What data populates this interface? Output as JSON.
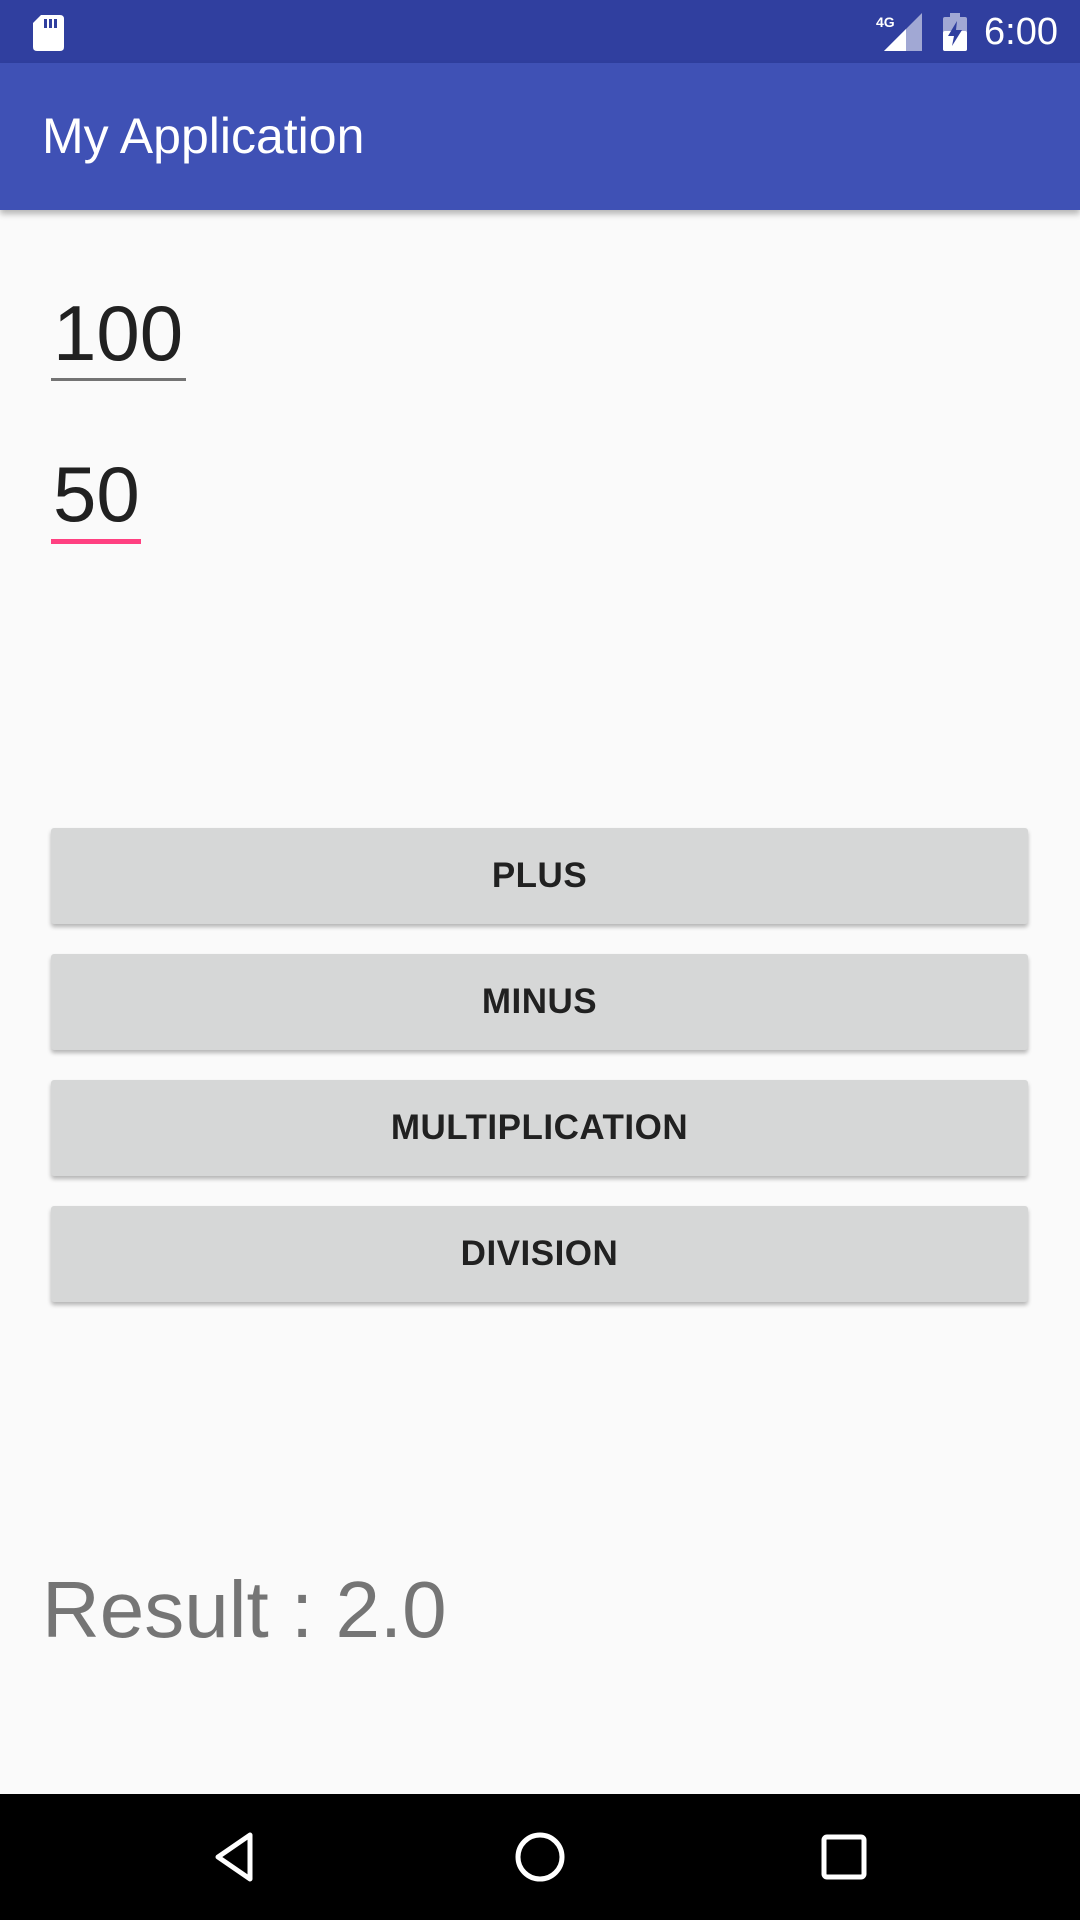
{
  "status_bar": {
    "time": "6:00",
    "network_label": "4G",
    "icons": [
      "sd-card-icon",
      "signal-4g-icon",
      "battery-charging-icon"
    ]
  },
  "app_bar": {
    "title": "My Application"
  },
  "inputs": {
    "first_value": "100",
    "second_value": "50"
  },
  "buttons": {
    "plus": "PLUS",
    "minus": "MINUS",
    "multiplication": "MULTIPLICATION",
    "division": "DIVISION"
  },
  "result": {
    "text": "Result : 2.0"
  },
  "nav_bar": {
    "icons": [
      "back-icon",
      "home-icon",
      "recents-icon"
    ]
  },
  "colors": {
    "primary": "#3f51b5",
    "primary_dark": "#303f9f",
    "accent": "#ff4081",
    "button_bg": "#d6d7d7",
    "background": "#fafafa"
  }
}
